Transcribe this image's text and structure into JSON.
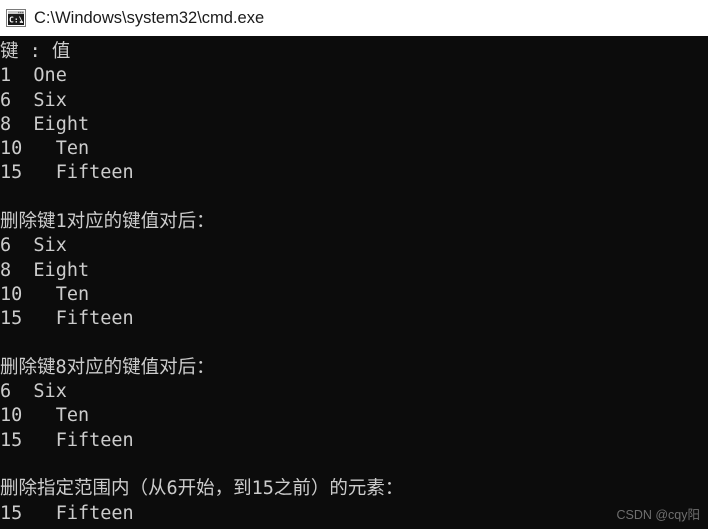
{
  "window": {
    "title": "C:\\Windows\\system32\\cmd.exe",
    "icon": "cmd-console-icon",
    "titlebar_bg": "#ffffff",
    "titlebar_fg": "#1b1b1b"
  },
  "console": {
    "background": "#0c0c0c",
    "foreground": "#cccccc",
    "lines": [
      "键 : 值",
      "1\tOne",
      "6\tSix",
      "8\tEight",
      "10\tTen",
      "15\tFifteen",
      "",
      "删除键1对应的键值对后：",
      "6\tSix",
      "8\tEight",
      "10\tTen",
      "15\tFifteen",
      "",
      "删除键8对应的键值对后：",
      "6\tSix",
      "10\tTen",
      "15\tFifteen",
      "",
      "删除指定范围内（从6开始，到15之前）的元素：",
      "15\tFifteen"
    ]
  },
  "watermark": {
    "text": "CSDN @cqy阳",
    "color": "#6f6f6f"
  }
}
